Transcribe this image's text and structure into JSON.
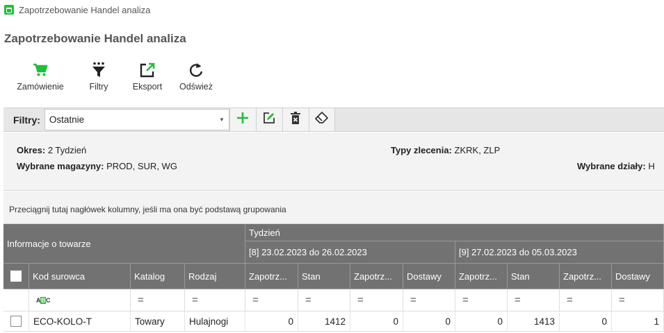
{
  "window": {
    "title": "Zapotrzebowanie Handel analiza"
  },
  "page": {
    "title": "Zapotrzebowanie Handel analiza"
  },
  "toolbar": {
    "order_label": "Zamówienie",
    "filters_label": "Filtry",
    "export_label": "Eksport",
    "refresh_label": "Odśwież"
  },
  "filterbar": {
    "label": "Filtry:",
    "selected": "Ostatnie"
  },
  "info": {
    "period_label": "Okres:",
    "period_value": "2 Tydzień",
    "warehouses_label": "Wybrane magazyny:",
    "warehouses_value": "PROD, SUR, WG",
    "order_types_label": "Typy zlecenia:",
    "order_types_value": "ZKRK, ZLP",
    "departments_label": "Wybrane działy:",
    "departments_value": "H"
  },
  "grouping_hint": "Przeciągnij tutaj nagłówek kolumny, jeśli ma ona być podstawą grupowania",
  "grid": {
    "band_left": "Informacje o towarze",
    "band_week": "Tydzień",
    "week1": "[8] 23.02.2023 do 26.02.2023",
    "week2": "[9] 27.02.2023 do 05.03.2023",
    "columns": {
      "code": "Kod surowca",
      "catalog": "Katalog",
      "type": "Rodzaj",
      "w1_demand": "Zapotrz...",
      "w1_stock": "Stan",
      "w1_demand2": "Zapotrz...",
      "w1_deliveries": "Dostawy",
      "w2_demand": "Zapotrz...",
      "w2_stock": "Stan",
      "w2_demand2": "Zapotrz...",
      "w2_deliveries": "Dostawy"
    },
    "filter_symbol": "=",
    "rows": [
      {
        "code": "ECO-KOLO-T",
        "catalog": "Towary",
        "type": "Hulajnogi",
        "w1_demand": "0",
        "w1_stock": "1412",
        "w1_demand2": "0",
        "w1_deliveries": "0",
        "w2_demand": "0",
        "w2_stock": "1413",
        "w2_demand2": "0",
        "w2_deliveries": "1"
      }
    ]
  },
  "colors": {
    "accent": "#1fbf3a",
    "header": "#727272"
  }
}
